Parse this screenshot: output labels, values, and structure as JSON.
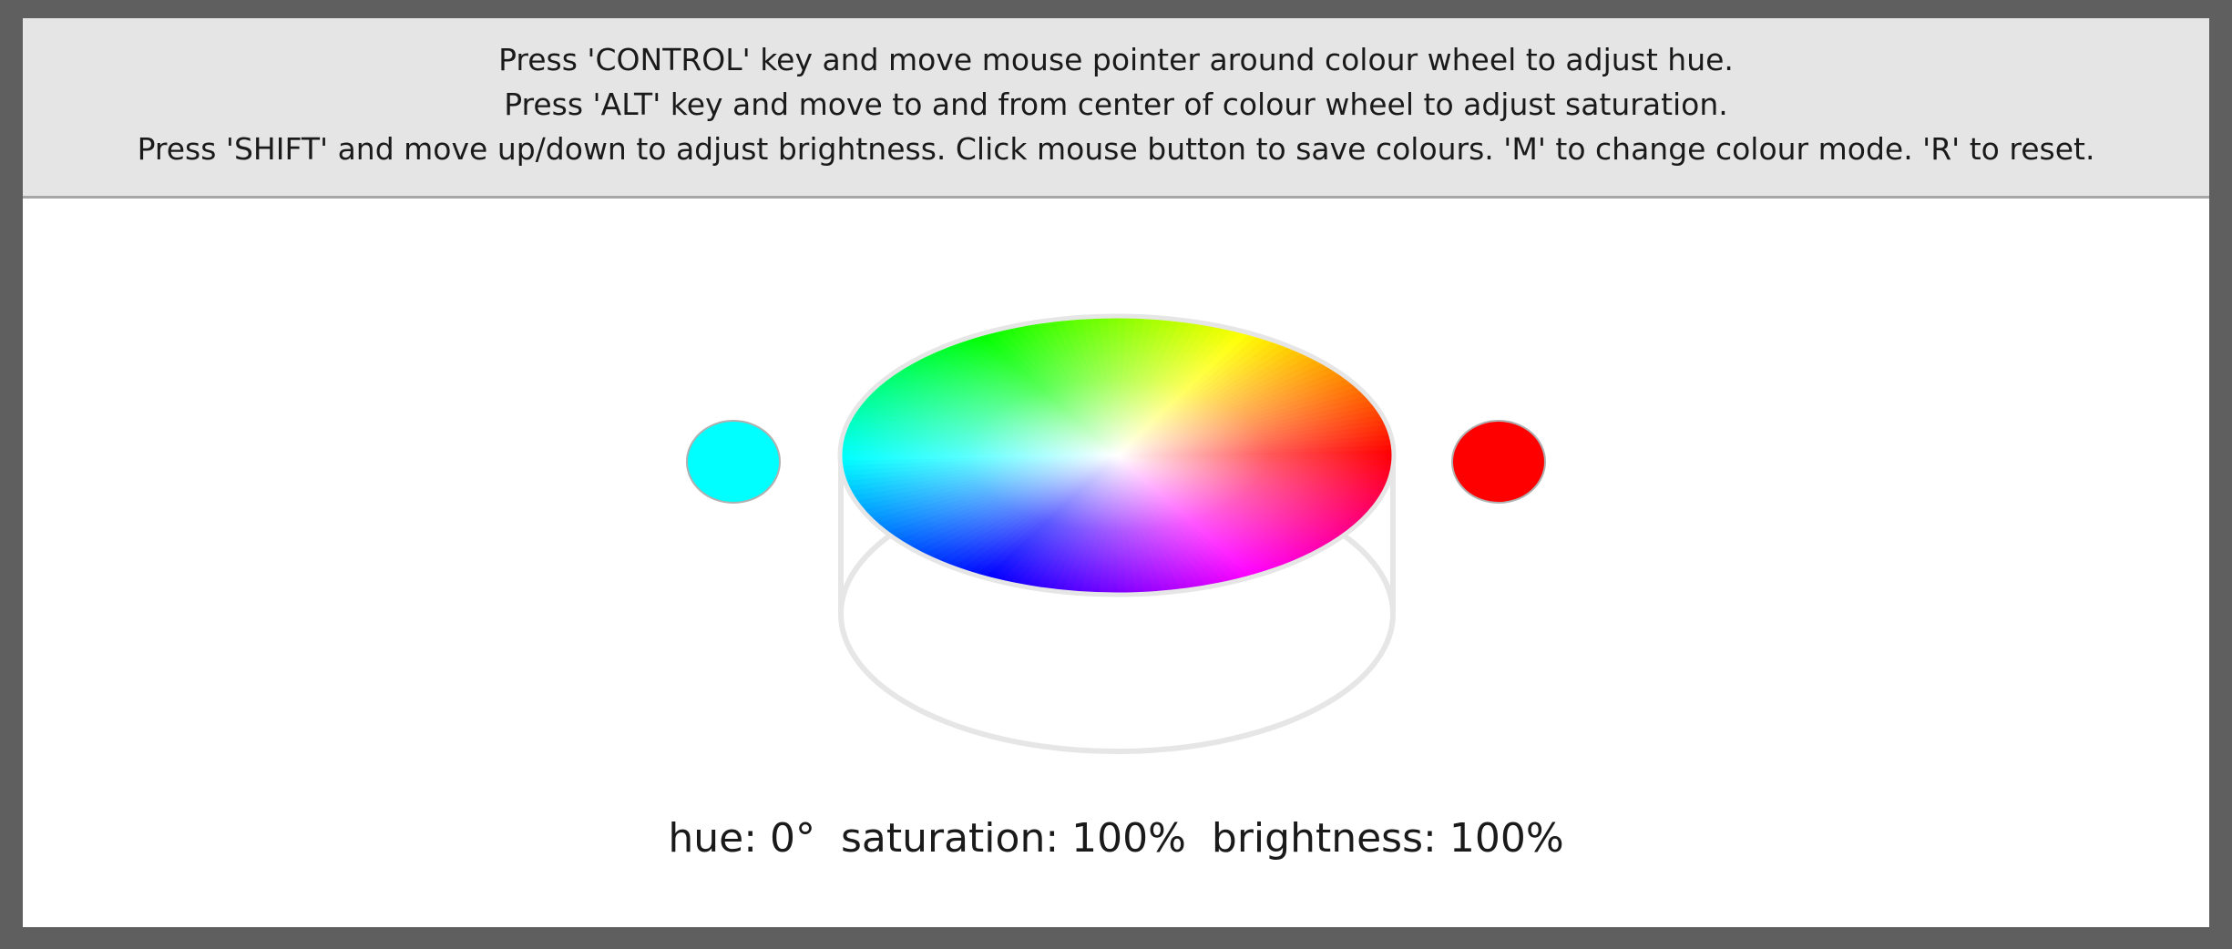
{
  "instructions": {
    "line1": "Press 'CONTROL' key and move mouse pointer around colour wheel to adjust hue.",
    "line2": "Press 'ALT' key and move to and from center of colour wheel to adjust saturation.",
    "line3": "Press 'SHIFT' and move up/down to adjust brightness.  Click mouse button to save colours.  'M' to change colour mode.  'R' to reset."
  },
  "readout": {
    "text": "hue: 0°  saturation: 100%  brightness: 100%"
  },
  "colors": {
    "left_swatch": "#00ffff",
    "right_swatch": "#ff0000",
    "outline": "#e6e6e6",
    "swatch_border": "#b0b0b0"
  },
  "state": {
    "hue_degrees": 0,
    "saturation_percent": 100,
    "brightness_percent": 100
  }
}
